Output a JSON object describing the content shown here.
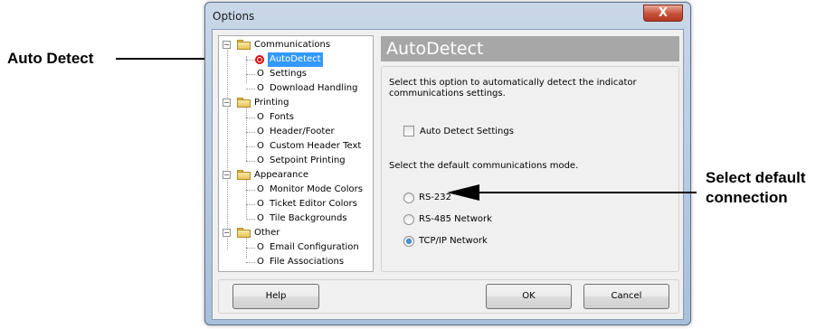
{
  "annotations": {
    "auto_detect": "Auto Detect",
    "select_default_line1": "Select default",
    "select_default_line2": "connection"
  },
  "window": {
    "title": "Options",
    "close_glyph": "X"
  },
  "tree": {
    "groups": [
      {
        "label": "Communications",
        "items": [
          "AutoDetect",
          "Settings",
          "Download Handling"
        ]
      },
      {
        "label": "Printing",
        "items": [
          "Fonts",
          "Header/Footer",
          "Custom Header Text",
          "Setpoint Printing"
        ]
      },
      {
        "label": "Appearance",
        "items": [
          "Monitor Mode Colors",
          "Ticket Editor Colors",
          "Tile Backgrounds"
        ]
      },
      {
        "label": "Other",
        "items": [
          "Email Configuration",
          "File Associations"
        ]
      }
    ],
    "selected_item": "AutoDetect",
    "expander_glyph": "−",
    "leaf_glyph": "O"
  },
  "panel": {
    "header": "AutoDetect",
    "description": "Select this option to automatically detect the indicator communications settings.",
    "checkbox_label": "Auto Detect Settings",
    "checkbox_checked": false,
    "mode_prompt": "Select the default communications mode.",
    "modes": [
      "RS-232",
      "RS-485 Network",
      "TCP/IP Network"
    ],
    "selected_mode": "TCP/IP Network"
  },
  "buttons": {
    "help": "Help",
    "ok": "OK",
    "cancel": "Cancel"
  }
}
